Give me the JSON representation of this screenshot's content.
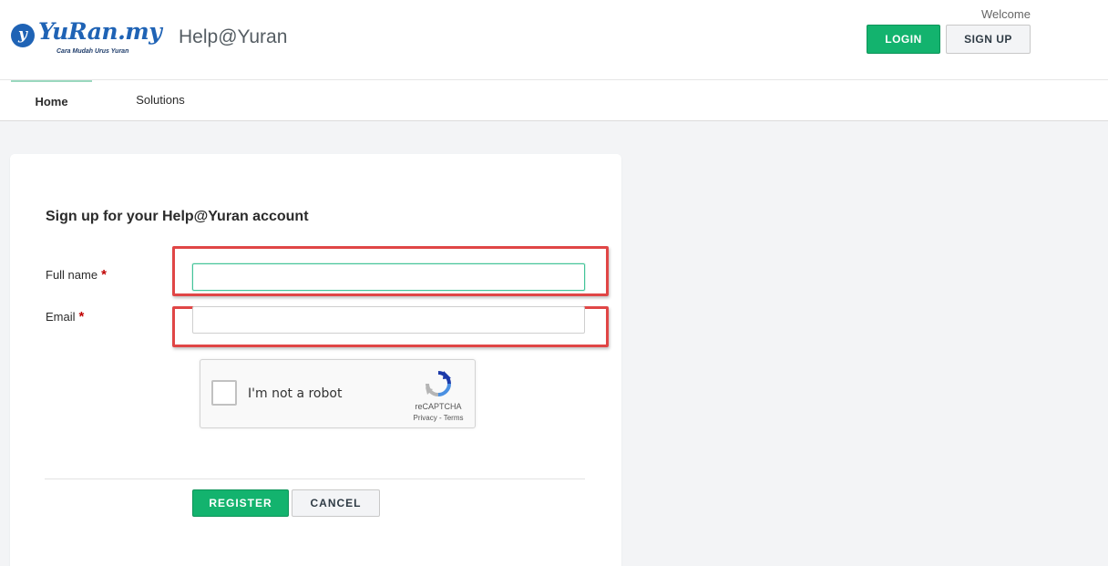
{
  "header": {
    "logo_mark": "y",
    "logo_word": "YuRan.my",
    "logo_tagline": "Cara Mudah Urus Yuran",
    "site_name": "Help@Yuran",
    "welcome": "Welcome",
    "login_label": "LOGIN",
    "signup_label": "SIGN UP"
  },
  "nav": {
    "items": [
      {
        "label": "Home",
        "active": true
      },
      {
        "label": "Solutions",
        "active": false
      }
    ]
  },
  "form": {
    "title": "Sign up for your Help@Yuran account",
    "required_marker": "*",
    "fields": [
      {
        "label": "Full name",
        "value": "",
        "placeholder": "",
        "required": true,
        "focused": true
      },
      {
        "label": "Email",
        "value": "",
        "placeholder": "",
        "required": true,
        "focused": false
      }
    ],
    "captcha": {
      "label": "I'm not a robot",
      "brand": "reCAPTCHA",
      "links": "Privacy - Terms"
    },
    "register_label": "REGISTER",
    "cancel_label": "CANCEL"
  },
  "colors": {
    "primary_green": "#13b36e",
    "brand_blue": "#1f63b5",
    "highlight_red": "#e04646",
    "page_bg": "#f3f4f6"
  },
  "icons": [
    "logo-icon",
    "recaptcha-icon"
  ]
}
